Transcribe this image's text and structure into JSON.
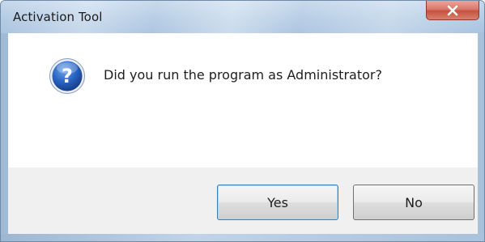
{
  "window": {
    "title": "Activation Tool"
  },
  "dialog": {
    "icon": "question-icon",
    "message": "Did you run the program as Administrator?"
  },
  "buttons": {
    "yes_label": "Yes",
    "no_label": "No"
  },
  "colors": {
    "close_button": "#d9786a",
    "default_button_border": "#3c7fb1",
    "icon_blue": "#1f5fb8"
  }
}
